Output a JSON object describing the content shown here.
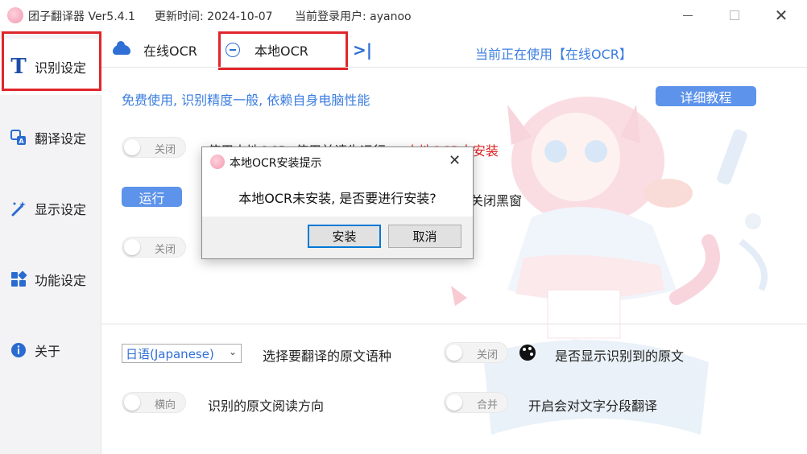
{
  "titlebar": {
    "title": "团子翻译器 Ver5.4.1",
    "update_time": "更新时间: 2024-10-07",
    "current_user": "当前登录用户: ayanoo",
    "close_glyph": "✕"
  },
  "sidebar": {
    "items": [
      {
        "label": "识别设定",
        "icon": "T"
      },
      {
        "label": "翻译设定",
        "icon": "translate-icon"
      },
      {
        "label": "显示设定",
        "icon": "magic-wand-icon"
      },
      {
        "label": "功能设定",
        "icon": "grid-icon"
      },
      {
        "label": "关于",
        "icon": "info-icon"
      }
    ]
  },
  "tabs": {
    "online": "在线OCR",
    "local": "本地OCR",
    "collapse_glyph": ">|",
    "current_using": "当前正在使用【在线OCR】"
  },
  "content": {
    "description": "免费使用, 识别精度一般, 依赖自身电脑性能",
    "tutorial_button": "详细教程",
    "toggle_off_1": "关闭",
    "row1_text": "使用本地OCR, 使用前请先运行",
    "row1_status": "本地OCR未安装",
    "run_button": "运行",
    "row2_partial": "关闭黑窗",
    "toggle_off_2": "关闭",
    "language_select": "日语(Japanese)",
    "language_label": "选择要翻译的原文语种",
    "toggle_show_original": "关闭",
    "show_original_label": "是否显示识别到的原文",
    "toggle_direction": "横向",
    "direction_label": "识别的原文阅读方向",
    "toggle_merge": "合并",
    "merge_label": "开启会对文字分段翻译"
  },
  "dialog": {
    "title": "本地OCR安装提示",
    "message": "本地OCR未安装, 是否要进行安装?",
    "install_button": "安装",
    "cancel_button": "取消",
    "close_glyph": "✕"
  },
  "colors": {
    "accent": "#3b7de0",
    "button_blue": "#5d93ea",
    "highlight_red": "#e0262b",
    "status_red": "#e02020"
  }
}
